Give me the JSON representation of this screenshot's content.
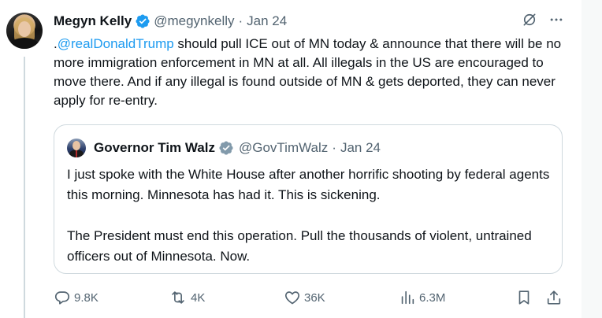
{
  "tweet": {
    "author_name": "Megyn Kelly",
    "handle": "@megynkelly",
    "separator": "·",
    "date": "Jan 24",
    "text_prefix": ".",
    "mention": "@realDonaldTrump",
    "text_body": " should pull ICE out of MN today & announce that there will be no more immigration enforcement in MN at all. All illegals in the US are encouraged to move there. And if any illegal is found outside of MN & gets deported, they can never apply for re-entry."
  },
  "quote": {
    "author_name": "Governor Tim Walz",
    "handle": "@GovTimWalz",
    "separator": "·",
    "date": "Jan 24",
    "paragraph_1": "I just spoke with the White House after another horrific shooting by federal agents this morning. Minnesota has had it. This is sickening.",
    "paragraph_2": "The President must end this operation. Pull the thousands of violent, untrained officers out of Minnesota. Now."
  },
  "actions": {
    "replies": "9.8K",
    "reposts": "4K",
    "likes": "36K",
    "views": "6.3M"
  },
  "colors": {
    "verified_blue": "#1d9bf0",
    "verified_gray": "#829aab",
    "link": "#1d9bf0",
    "secondary_text": "#536471"
  }
}
